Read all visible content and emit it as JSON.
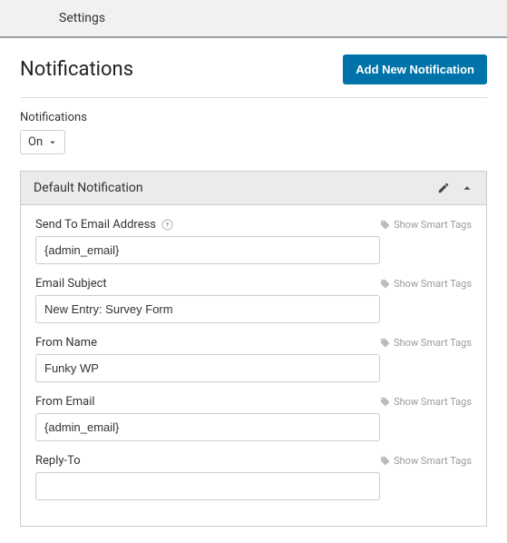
{
  "tabs": {
    "active": "Settings"
  },
  "page": {
    "title": "Notifications",
    "add_button": "Add New Notification"
  },
  "toggle": {
    "label": "Notifications",
    "value": "On"
  },
  "panel": {
    "title": "Default Notification",
    "smart_tags_label": "Show Smart Tags",
    "fields": {
      "send_to": {
        "label": "Send To Email Address",
        "value": "{admin_email}"
      },
      "subject": {
        "label": "Email Subject",
        "value": "New Entry: Survey Form"
      },
      "from_name": {
        "label": "From Name",
        "value": "Funky WP"
      },
      "from_email": {
        "label": "From Email",
        "value": "{admin_email}"
      },
      "reply_to": {
        "label": "Reply-To",
        "value": ""
      }
    }
  }
}
